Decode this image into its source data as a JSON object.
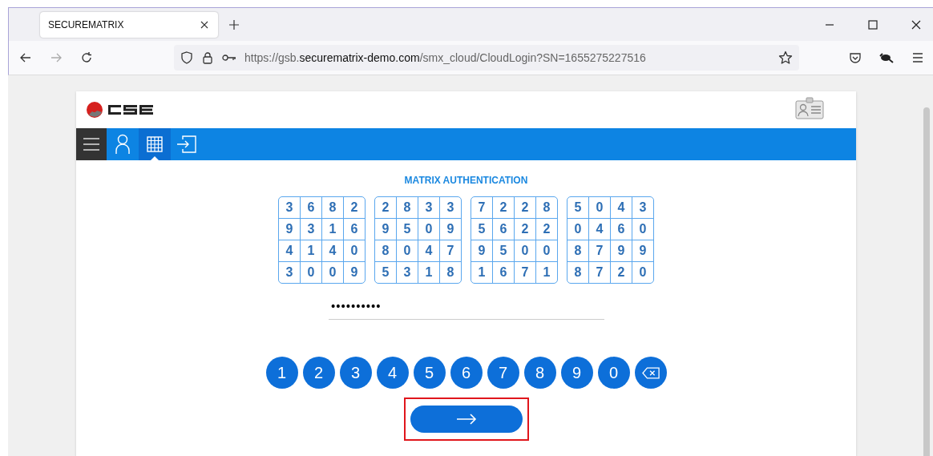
{
  "browser": {
    "tab_title": "SECUREMATRIX",
    "url": {
      "prefix": "https://gsb.",
      "domain": "securematrix-demo.com",
      "path": "/smx_cloud/CloudLogin?SN=1655275227516"
    }
  },
  "nav": [
    {
      "kind": "menu",
      "selected": false
    },
    {
      "kind": "user",
      "selected": false
    },
    {
      "kind": "grid",
      "selected": true
    },
    {
      "kind": "login",
      "selected": false
    }
  ],
  "title": "MATRIX AUTHENTICATION",
  "matrices": [
    [
      [
        "3",
        "6",
        "8",
        "2"
      ],
      [
        "9",
        "3",
        "1",
        "6"
      ],
      [
        "4",
        "1",
        "4",
        "0"
      ],
      [
        "3",
        "0",
        "0",
        "9"
      ]
    ],
    [
      [
        "2",
        "8",
        "3",
        "3"
      ],
      [
        "9",
        "5",
        "0",
        "9"
      ],
      [
        "8",
        "0",
        "4",
        "7"
      ],
      [
        "5",
        "3",
        "1",
        "8"
      ]
    ],
    [
      [
        "7",
        "2",
        "2",
        "8"
      ],
      [
        "5",
        "6",
        "2",
        "2"
      ],
      [
        "9",
        "5",
        "0",
        "0"
      ],
      [
        "1",
        "6",
        "7",
        "1"
      ]
    ],
    [
      [
        "5",
        "0",
        "4",
        "3"
      ],
      [
        "0",
        "4",
        "6",
        "0"
      ],
      [
        "8",
        "7",
        "9",
        "9"
      ],
      [
        "8",
        "7",
        "2",
        "0"
      ]
    ]
  ],
  "password": {
    "value": "••••••••••"
  },
  "keys": [
    {
      "kind": "digit",
      "label": "1"
    },
    {
      "kind": "digit",
      "label": "2"
    },
    {
      "kind": "digit",
      "label": "3"
    },
    {
      "kind": "digit",
      "label": "4"
    },
    {
      "kind": "digit",
      "label": "5"
    },
    {
      "kind": "digit",
      "label": "6"
    },
    {
      "kind": "digit",
      "label": "7"
    },
    {
      "kind": "digit",
      "label": "8"
    },
    {
      "kind": "digit",
      "label": "9"
    },
    {
      "kind": "digit",
      "label": "0"
    },
    {
      "kind": "backspace"
    }
  ],
  "submit": {
    "highlighted": true
  }
}
